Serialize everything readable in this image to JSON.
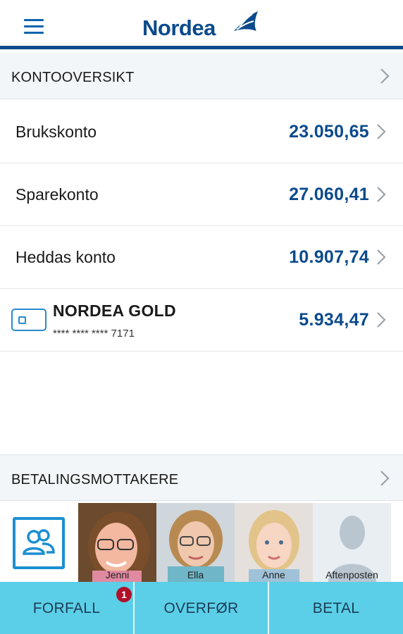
{
  "header": {
    "logo_text": "Nordea"
  },
  "accounts_section": {
    "title": "KONTOOVERSIKT"
  },
  "accounts": [
    {
      "name": "Brukskonto",
      "amount": "23.050,65"
    },
    {
      "name": "Sparekonto",
      "amount": "27.060,41"
    },
    {
      "name": "Heddas konto",
      "amount": "10.907,74"
    }
  ],
  "card": {
    "name": "NORDEA GOLD",
    "number": "**** **** **** 7171",
    "amount": "5.934,47"
  },
  "payees_section": {
    "title": "BETALINGSMOTTAKERE"
  },
  "payees": [
    {
      "name": "Jenni"
    },
    {
      "name": "Ella"
    },
    {
      "name": "Anne"
    },
    {
      "name": "Aftenposten"
    }
  ],
  "tabs": [
    {
      "label": "FORFALL",
      "badge": "1"
    },
    {
      "label": "OVERFØR"
    },
    {
      "label": "BETAL"
    }
  ],
  "colors": {
    "brand": "#0b4a8c",
    "accent": "#5ccfe8",
    "badge": "#b0102a"
  }
}
